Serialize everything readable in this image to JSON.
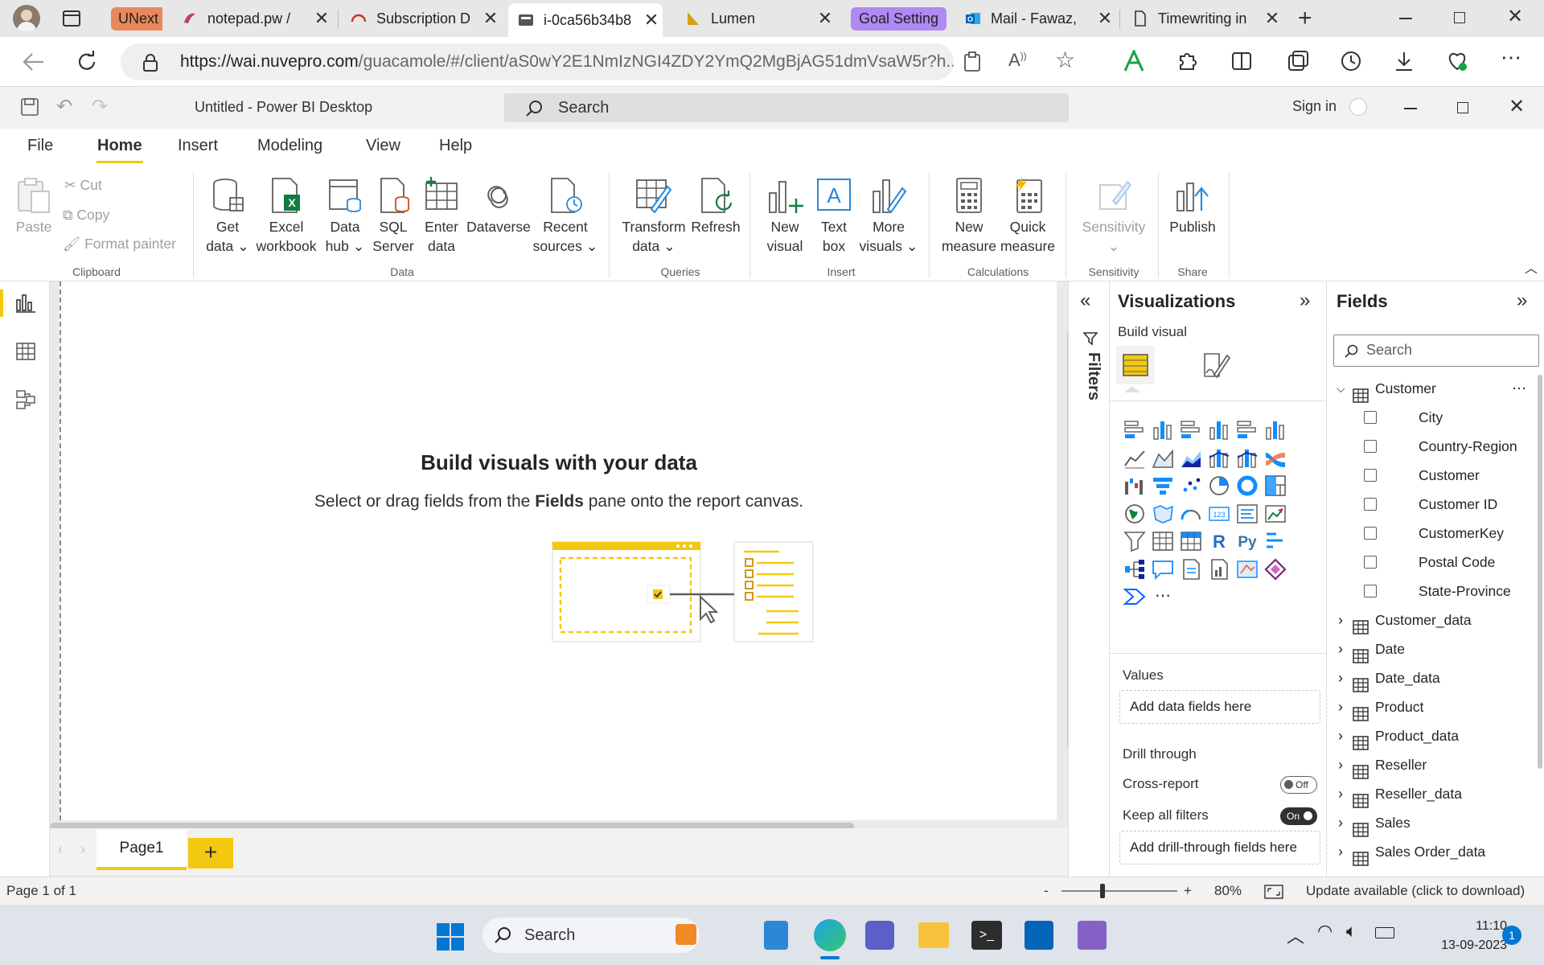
{
  "browser": {
    "tabs": [
      {
        "label": "UNext",
        "type": "group",
        "color": "#e9875c"
      },
      {
        "label": "notepad.pw / "
      },
      {
        "label": "Subscription D"
      },
      {
        "label": "i-0ca56b34b8",
        "active": true
      },
      {
        "label": "Lumen"
      },
      {
        "label": "Goal Setting",
        "type": "group",
        "color": "#b089f2"
      },
      {
        "label": "Mail - Fawaz, "
      },
      {
        "label": "Timewriting in"
      }
    ],
    "url_domain": "https://wai.nuvepro.com",
    "url_path": "/guacamole/#/client/aS0wY2E1NmIzNGI4ZDY2YmQ2MgBjAG51dmVsaW5r?h..."
  },
  "app": {
    "title": "Untitled - Power BI Desktop",
    "search_placeholder": "Search",
    "sign_in": "Sign in"
  },
  "menu": [
    "File",
    "Home",
    "Insert",
    "Modeling",
    "View",
    "Help"
  ],
  "ribbon": {
    "clipboard": {
      "paste": "Paste",
      "cut": "Cut",
      "copy": "Copy",
      "format_painter": "Format painter",
      "group": "Clipboard"
    },
    "data": {
      "get_data": [
        "Get",
        "data"
      ],
      "excel": [
        "Excel",
        "workbook"
      ],
      "data_hub": [
        "Data",
        "hub"
      ],
      "sql": [
        "SQL",
        "Server"
      ],
      "enter": [
        "Enter",
        "data"
      ],
      "dataverse": [
        "Dataverse",
        ""
      ],
      "recent": [
        "Recent",
        "sources"
      ],
      "group": "Data"
    },
    "queries": {
      "transform": [
        "Transform",
        "data"
      ],
      "refresh": [
        "Refresh",
        ""
      ],
      "group": "Queries"
    },
    "insert": {
      "new_visual": [
        "New",
        "visual"
      ],
      "text_box": [
        "Text",
        "box"
      ],
      "more_visuals": [
        "More",
        "visuals"
      ],
      "group": "Insert"
    },
    "calculations": {
      "new_measure": [
        "New",
        "measure"
      ],
      "quick_measure": [
        "Quick",
        "measure"
      ],
      "group": "Calculations"
    },
    "sensitivity": {
      "label": "Sensitivity",
      "group": "Sensitivity"
    },
    "share": {
      "publish": "Publish",
      "group": "Share"
    }
  },
  "canvas": {
    "heading": "Build visuals with your data",
    "sub_pre": "Select or drag fields from the ",
    "sub_bold": "Fields",
    "sub_post": " pane onto the report canvas."
  },
  "pages": {
    "tab": "Page1",
    "add": "+"
  },
  "filters": {
    "label": "Filters"
  },
  "visualizations": {
    "title": "Visualizations",
    "build_visual": "Build visual",
    "values_label": "Values",
    "values_placeholder": "Add data fields here",
    "drill_through": "Drill through",
    "cross_report": "Cross-report",
    "cross_report_state": "Off",
    "keep_filters": "Keep all filters",
    "keep_filters_state": "On",
    "drill_placeholder": "Add drill-through fields here"
  },
  "fields": {
    "title": "Fields",
    "search_placeholder": "Search",
    "expanded_table": "Customer",
    "columns": [
      "City",
      "Country-Region",
      "Customer",
      "Customer ID",
      "CustomerKey",
      "Postal Code",
      "State-Province"
    ],
    "tables": [
      "Customer_data",
      "Date",
      "Date_data",
      "Product",
      "Product_data",
      "Reseller",
      "Reseller_data",
      "Sales",
      "Sales Order_data"
    ]
  },
  "status": {
    "page": "Page 1 of 1",
    "zoom": "80%",
    "update": "Update available (click to download)",
    "zoom_minus": "-",
    "zoom_plus": "+"
  },
  "taskbar": {
    "search": "Search",
    "time": "11:10",
    "date": "13-09-2023",
    "notifications": "1"
  },
  "colors": {
    "accent": "#f2c811",
    "browser_bg": "#e7e7e7"
  }
}
